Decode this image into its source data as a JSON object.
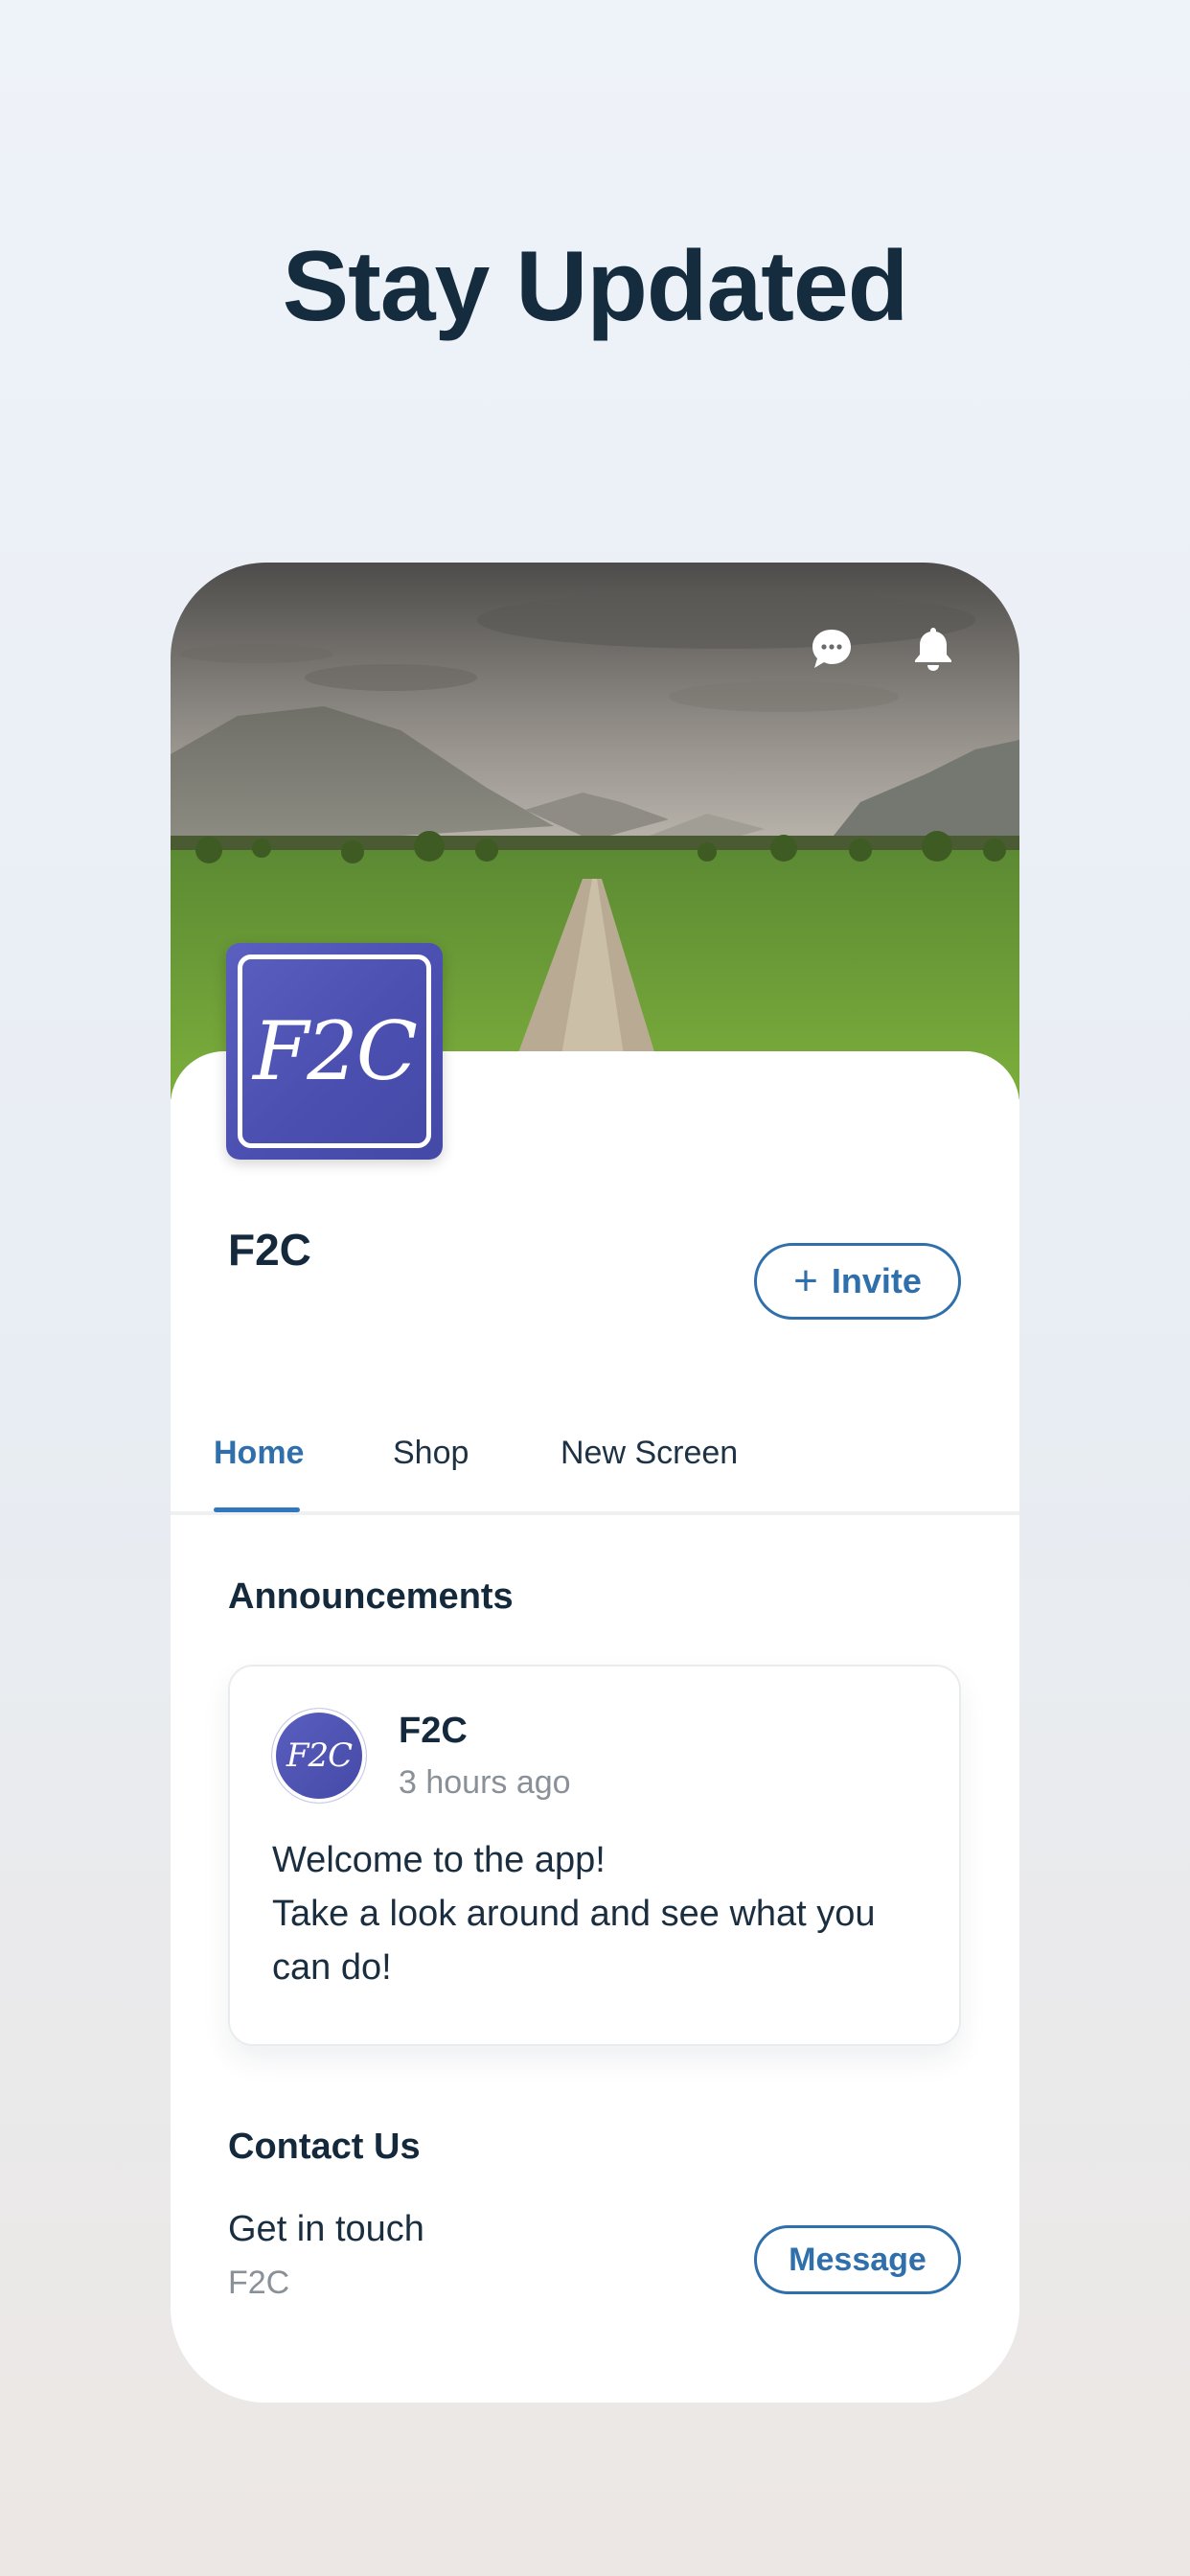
{
  "hero": {
    "title": "Stay Updated"
  },
  "header": {
    "chat_icon": "chat-bubble-icon",
    "bell_icon": "bell-icon"
  },
  "site": {
    "logo_text": "F2C",
    "name": "F2C",
    "invite_label": "Invite",
    "invite_icon": "plus-icon"
  },
  "tabs": [
    {
      "label": "Home",
      "active": true
    },
    {
      "label": "Shop",
      "active": false
    },
    {
      "label": "New Screen",
      "active": false
    }
  ],
  "announcements": {
    "title": "Announcements",
    "post": {
      "avatar_text": "F2C",
      "author": "F2C",
      "time": "3 hours ago",
      "line1": "Welcome to the app!",
      "line2": "Take a look around and see what you",
      "line3": "can do!"
    }
  },
  "contact": {
    "title": "Contact Us",
    "subtitle": "Get in touch",
    "name": "F2C",
    "button_label": "Message"
  },
  "colors": {
    "accent": "#2f6fab",
    "text_dark": "#14293b",
    "text_muted": "#8a9097",
    "logo_blue": "#4b4fb0"
  }
}
